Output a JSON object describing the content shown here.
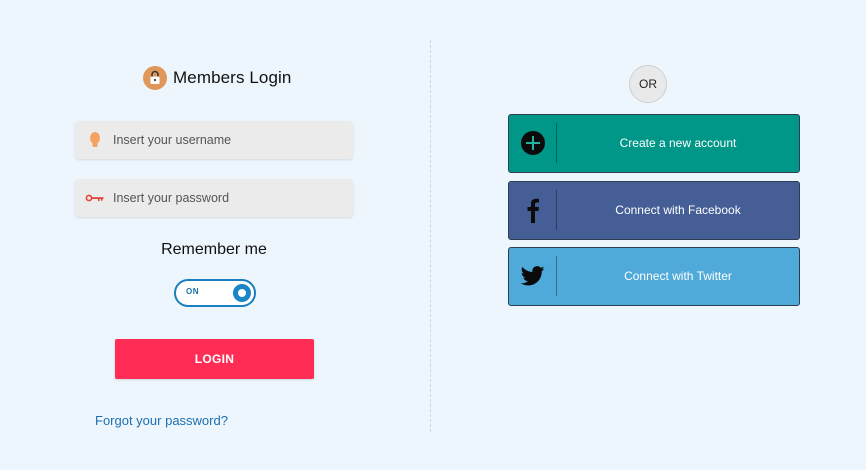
{
  "login": {
    "title": "Members Login",
    "username_placeholder": "Insert your username",
    "password_placeholder": "Insert your password",
    "remember_label": "Remember me",
    "toggle_label": "ON",
    "login_label": "LOGIN",
    "forgot_label": "Forgot your password?"
  },
  "social": {
    "or_label": "OR",
    "create_label": "Create a new account",
    "facebook_label": "Connect with Facebook",
    "twitter_label": "Connect with Twitter"
  },
  "colors": {
    "background": "#eef6fd",
    "login_button": "#ff2d55",
    "create_button": "#009688",
    "facebook_button": "#455e96",
    "twitter_button": "#4fa9d9",
    "toggle_accent": "#1a86c8",
    "link": "#1c6fb0"
  },
  "icons": {
    "title": "lock-icon",
    "username": "person-icon",
    "password": "key-icon",
    "create": "plus-circle-icon",
    "facebook": "facebook-icon",
    "twitter": "twitter-bird-icon"
  },
  "state": {
    "remember_me_on": true
  }
}
